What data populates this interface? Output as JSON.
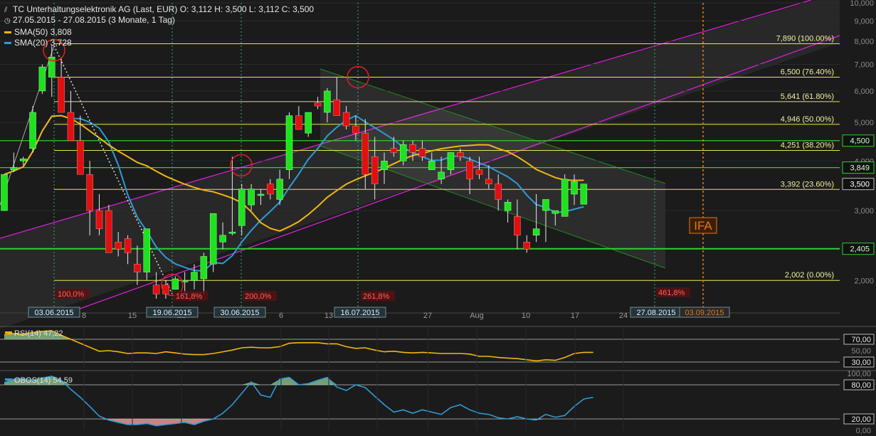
{
  "header": {
    "title": "TC Unterhaltungselektronik AG (Last, EUR)  O: 3,112  H: 3,500  L: 3,112  C: 3,500",
    "period": "27.05.2015 - 27.08.2015 (3 Monate, 1 Tag)",
    "sma50": "SMA(50)  3,808",
    "sma20": "SMA(20)  3,728"
  },
  "colors": {
    "up": "#1fe21f",
    "down": "#e01010",
    "sma50": "#f2b60f",
    "sma20": "#2e9bd6",
    "fib": "#e8e84a",
    "channel": "#d61fd6",
    "support": "#2ecf2e",
    "ifa": "#e07a1a",
    "rsi": "#f2b60f",
    "obos": "#2e9bd6"
  },
  "chart_data": {
    "type": "candlestick",
    "y_axis_scale": "log",
    "ylim": [
      1.8,
      10.0
    ],
    "y_ticks": [
      "10,000",
      "9,000",
      "8,000",
      "7,000",
      "6,000",
      "5,000",
      "4,000",
      "3,000",
      "2,000"
    ],
    "x_ticks": [
      "8",
      "15",
      "22",
      "6",
      "13",
      "20",
      "27",
      "Aug",
      "10",
      "17",
      "24"
    ],
    "date_labels": [
      "03.06.2015",
      "19.06.2015",
      "30.06.2015",
      "16.07.2015",
      "27.08.2015",
      "03.09.2015"
    ],
    "candles": [
      [
        3.0,
        3.7,
        3.1,
        3.7
      ],
      [
        3.8,
        4.2,
        3.75,
        3.85
      ],
      [
        4.0,
        4.1,
        3.9,
        4.05
      ],
      [
        4.3,
        5.5,
        4.2,
        5.3
      ],
      [
        6.0,
        7.0,
        5.9,
        6.9
      ],
      [
        6.5,
        7.8,
        5.8,
        7.3
      ],
      [
        6.5,
        7.3,
        5.5,
        5.3
      ],
      [
        5.3,
        6.0,
        4.7,
        4.5
      ],
      [
        4.5,
        5.2,
        3.8,
        3.7
      ],
      [
        3.7,
        4.0,
        2.6,
        3.0
      ],
      [
        3.0,
        3.3,
        2.6,
        2.7
      ],
      [
        3.0,
        3.1,
        2.4,
        2.35
      ],
      [
        2.5,
        2.65,
        2.3,
        2.4
      ],
      [
        2.55,
        2.6,
        2.2,
        2.35
      ],
      [
        2.2,
        2.45,
        1.95,
        2.1
      ],
      [
        2.1,
        2.7,
        2.0,
        2.7
      ],
      [
        1.95,
        2.1,
        1.8,
        1.85
      ],
      [
        1.95,
        2.0,
        1.8,
        1.85
      ],
      [
        1.9,
        2.05,
        1.9,
        2.02
      ],
      [
        2.0,
        2.1,
        1.85,
        2.0
      ],
      [
        2.0,
        2.2,
        1.9,
        2.1
      ],
      [
        2.02,
        2.35,
        1.85,
        2.3
      ],
      [
        2.2,
        2.6,
        2.1,
        2.95
      ],
      [
        2.5,
        2.8,
        2.4,
        2.6
      ],
      [
        2.65,
        4.1,
        2.6,
        2.65
      ],
      [
        2.75,
        3.5,
        2.6,
        3.4
      ],
      [
        3.1,
        3.5,
        3.0,
        3.4
      ],
      [
        3.3,
        3.4,
        3.1,
        3.3
      ],
      [
        3.5,
        3.6,
        3.2,
        3.3
      ],
      [
        3.2,
        3.8,
        3.1,
        3.6
      ],
      [
        3.8,
        5.3,
        3.6,
        5.2
      ],
      [
        5.2,
        5.5,
        4.8,
        4.8
      ],
      [
        4.7,
        5.3,
        4.6,
        5.3
      ],
      [
        5.6,
        5.8,
        5.4,
        5.5
      ],
      [
        5.3,
        6.1,
        5.0,
        6.0
      ],
      [
        5.7,
        6.5,
        5.2,
        5.2
      ],
      [
        5.3,
        5.5,
        4.8,
        4.9
      ],
      [
        4.9,
        5.2,
        4.5,
        4.7
      ],
      [
        4.7,
        5.1,
        3.4,
        3.7
      ],
      [
        4.1,
        4.6,
        3.2,
        3.5
      ],
      [
        3.8,
        4.2,
        3.5,
        4.0
      ],
      [
        4.3,
        4.6,
        4.1,
        4.2
      ],
      [
        4.0,
        4.5,
        3.9,
        4.4
      ],
      [
        4.4,
        4.5,
        4.0,
        4.2
      ],
      [
        4.3,
        4.5,
        4.0,
        4.1
      ],
      [
        3.8,
        4.2,
        3.8,
        4.0
      ],
      [
        3.6,
        4.1,
        3.5,
        3.75
      ],
      [
        3.8,
        4.1,
        3.7,
        4.2
      ],
      [
        4.2,
        4.3,
        4.0,
        4.1
      ],
      [
        4.0,
        4.1,
        3.3,
        3.6
      ],
      [
        3.8,
        4.1,
        3.6,
        3.7
      ],
      [
        3.6,
        3.9,
        3.4,
        3.5
      ],
      [
        3.5,
        3.7,
        3.0,
        3.2
      ],
      [
        3.0,
        3.2,
        2.8,
        3.15
      ],
      [
        2.9,
        3.2,
        2.4,
        2.6
      ],
      [
        2.5,
        2.6,
        2.35,
        2.4
      ],
      [
        2.6,
        3.3,
        2.5,
        2.7
      ],
      [
        3.0,
        3.1,
        2.5,
        3.2
      ],
      [
        2.95,
        3.0,
        2.75,
        3.0
      ],
      [
        2.9,
        3.7,
        2.9,
        3.6
      ],
      [
        3.3,
        3.7,
        3.1,
        3.55
      ],
      [
        3.112,
        3.5,
        3.112,
        3.5
      ]
    ],
    "fibonacci_levels": [
      {
        "label": "7,890 (100.00%)",
        "value": 7.89
      },
      {
        "label": "6,500 (76.40%)",
        "value": 6.5
      },
      {
        "label": "5,641 (61.80%)",
        "value": 5.641
      },
      {
        "label": "4,946 (50.00%)",
        "value": 4.946
      },
      {
        "label": "4,251 (38.20%)",
        "value": 4.251
      },
      {
        "label": "3,392 (23.60%)",
        "value": 3.392
      },
      {
        "label": "2,002 (0.00%)",
        "value": 2.002
      }
    ],
    "price_badges": [
      {
        "label": "4,500",
        "value": 4.5,
        "color": "#2ecf2e"
      },
      {
        "label": "3,849",
        "value": 3.849,
        "color": "#2ecf2e"
      },
      {
        "label": "3,500",
        "value": 3.5,
        "color": "#ffffff"
      },
      {
        "label": "2,405",
        "value": 2.405,
        "color": "#2ecf2e"
      }
    ],
    "projection_labels": [
      "100,0%",
      "161,8%",
      "200,0%",
      "261,8%",
      "461,8%"
    ],
    "ifa_label": "IFA",
    "rsi": {
      "label": "RSI(14)  47,22",
      "ticks": [
        "70,00",
        "50,00",
        "30,00"
      ],
      "values": [
        78,
        80,
        79,
        82,
        84,
        85,
        77,
        70,
        63,
        56,
        49,
        50,
        48,
        45,
        46,
        46,
        45,
        48,
        46,
        44,
        43,
        43,
        45,
        48,
        51,
        55,
        56,
        55,
        55,
        57,
        63,
        64,
        64,
        64,
        62,
        62,
        57,
        54,
        55,
        51,
        48,
        49,
        47,
        46,
        47,
        46,
        45,
        45,
        45,
        44,
        40,
        40,
        38,
        37,
        36,
        34,
        32,
        34,
        33,
        38,
        45,
        47,
        47
      ],
      "overbought": 70,
      "oversold": 30
    },
    "obos": {
      "label": "OBOS(14)  54,59",
      "ticks": [
        "100,00",
        "80,00",
        "20,00",
        "0,00"
      ],
      "values": [
        84,
        90,
        90,
        88,
        92,
        95,
        88,
        72,
        58,
        42,
        25,
        18,
        14,
        10,
        10,
        12,
        8,
        10,
        12,
        14,
        10,
        16,
        20,
        30,
        45,
        65,
        85,
        62,
        58,
        90,
        93,
        80,
        82,
        88,
        93,
        76,
        70,
        80,
        75,
        60,
        45,
        32,
        36,
        30,
        36,
        32,
        28,
        40,
        45,
        36,
        30,
        28,
        22,
        20,
        24,
        20,
        18,
        28,
        23,
        26,
        42,
        55,
        58
      ],
      "overbought": 80,
      "oversold": 20
    }
  }
}
